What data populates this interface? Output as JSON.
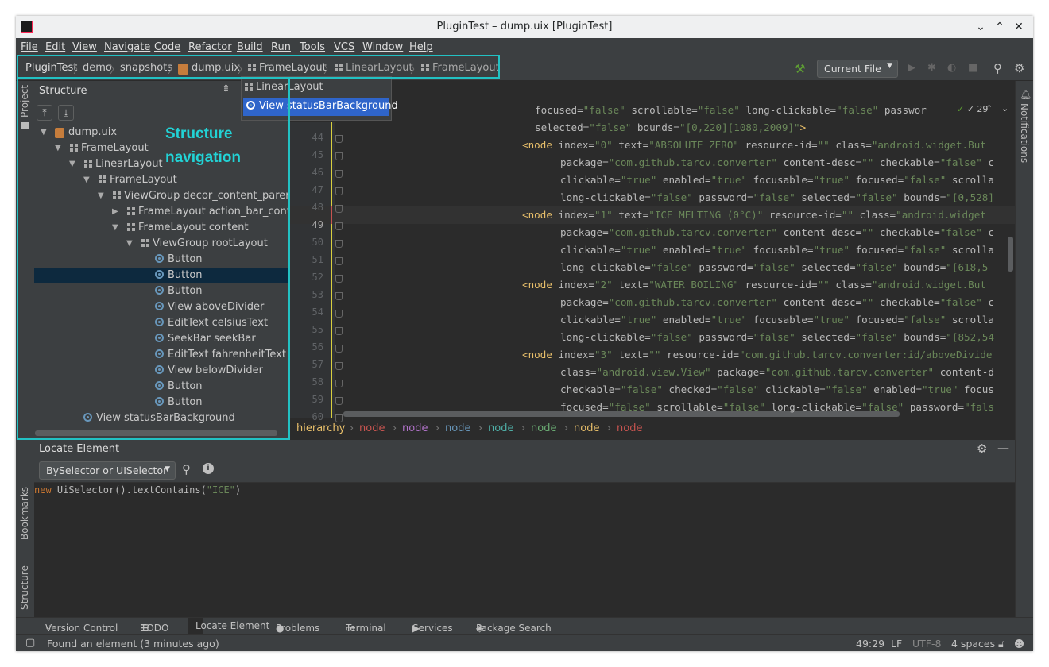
{
  "window": {
    "title": "PluginTest – dump.uix [PluginTest]"
  },
  "menu": [
    "File",
    "Edit",
    "View",
    "Navigate",
    "Code",
    "Refactor",
    "Build",
    "Run",
    "Tools",
    "VCS",
    "Window",
    "Help"
  ],
  "breadcrumbs": {
    "project": "PluginTest",
    "c1": "demo",
    "c2": "snapshots",
    "c3": "dump.uix",
    "c4": "FrameLayout",
    "c5": "LinearLayout",
    "c6": "FrameLayout"
  },
  "toolbar": {
    "run_config": "Current File"
  },
  "sidebar": {
    "project": "Project",
    "bookmarks": "Bookmarks",
    "structure": "Structure",
    "notifications": "Notifications"
  },
  "structure": {
    "title": "Structure",
    "rows": [
      {
        "label": "dump.uix"
      },
      {
        "label": "FrameLayout"
      },
      {
        "label": "LinearLayout"
      },
      {
        "label": "FrameLayout"
      },
      {
        "label": "ViewGroup decor_content_parent"
      },
      {
        "label": "FrameLayout action_bar_contain"
      },
      {
        "label": "FrameLayout content"
      },
      {
        "label": "ViewGroup rootLayout"
      },
      {
        "label": "Button"
      },
      {
        "label": "Button"
      },
      {
        "label": "Button"
      },
      {
        "label": "View aboveDivider"
      },
      {
        "label": "EditText celsiusText"
      },
      {
        "label": "SeekBar seekBar"
      },
      {
        "label": "EditText fahrenheitText"
      },
      {
        "label": "View belowDivider"
      },
      {
        "label": "Button"
      },
      {
        "label": "Button"
      },
      {
        "label": "View statusBarBackground"
      }
    ]
  },
  "popup": {
    "item1": "LinearLayout",
    "item2": "View statusBarBackground"
  },
  "annotation": {
    "line1": "Structure",
    "line2": "navigation"
  },
  "editor": {
    "line_numbers": [
      "44",
      "45",
      "46",
      "47",
      "48",
      "49",
      "50",
      "51",
      "52",
      "53",
      "54",
      "55",
      "56",
      "57",
      "58",
      "59",
      "60"
    ],
    "inspection": "✓ 29",
    "lines": [
      {
        "k": "",
        "a": "focused=",
        "v": "\"false\"",
        "rest": " scrollable=\"false\" long-clickable=\"false\" passwor"
      },
      {
        "k": "",
        "a": "selected=",
        "v": "\"false\"",
        "rest": " bounds=\"[0,220][1080,2009]\">"
      },
      {
        "k": "<node",
        "a": " index=",
        "v": "\"0\"",
        "rest": " text=\"ABSOLUTE ZERO\" resource-id=\"\" class=\"android.widget.But"
      },
      {
        "k": "",
        "a": "package=",
        "v": "\"com.github.tarcv.converter\"",
        "rest": " content-desc=\"\" checkable=\"false\" c"
      },
      {
        "k": "",
        "a": "clickable=",
        "v": "\"true\"",
        "rest": " enabled=\"true\" focusable=\"true\" focused=\"false\" scrolla"
      },
      {
        "k": "",
        "a": "long-clickable=",
        "v": "\"false\"",
        "rest": " password=\"false\" selected=\"false\" bounds=\"[0,528]"
      },
      {
        "k": "<node",
        "a": " index=",
        "v": "\"1\"",
        "rest": " text=\"ICE MELTING (0°C)\" resource-id=\"\" class=\"android.widget"
      },
      {
        "k": "",
        "a": "package=",
        "v": "\"com.github.tarcv.converter\"",
        "rest": " content-desc=\"\" checkable=\"false\" c"
      },
      {
        "k": "",
        "a": "clickable=",
        "v": "\"true\"",
        "rest": " enabled=\"true\" focusable=\"true\" focused=\"false\" scrolla"
      },
      {
        "k": "",
        "a": "long-clickable=",
        "v": "\"false\"",
        "rest": " password=\"false\" selected=\"false\" bounds=\"[618,5"
      },
      {
        "k": "<node",
        "a": " index=",
        "v": "\"2\"",
        "rest": " text=\"WATER BOILING\" resource-id=\"\" class=\"android.widget.But"
      },
      {
        "k": "",
        "a": "package=",
        "v": "\"com.github.tarcv.converter\"",
        "rest": " content-desc=\"\" checkable=\"false\" c"
      },
      {
        "k": "",
        "a": "clickable=",
        "v": "\"true\"",
        "rest": " enabled=\"true\" focusable=\"true\" focused=\"false\" scrolla"
      },
      {
        "k": "",
        "a": "long-clickable=",
        "v": "\"false\"",
        "rest": " password=\"false\" selected=\"false\" bounds=\"[852,54"
      },
      {
        "k": "<node",
        "a": " index=",
        "v": "\"3\"",
        "rest": " text=\"\" resource-id=\"com.github.tarcv.converter:id/aboveDivide"
      },
      {
        "k": "",
        "a": "class=",
        "v": "\"android.view.View\"",
        "rest": " package=\"com.github.tarcv.converter\" content-d"
      },
      {
        "k": "",
        "a": "checkable=",
        "v": "\"false\"",
        "rest": " checked=\"false\" clickable=\"false\" enabled=\"true\" focus"
      },
      {
        "k": "",
        "a": "focused=",
        "v": "\"false\"",
        "rest": " scrollable=\"false\" long-clickable=\"false\" password=\"fals"
      }
    ],
    "breadcrumb": [
      "hierarchy",
      "node",
      "node",
      "node",
      "node",
      "node",
      "node",
      "node"
    ]
  },
  "locate": {
    "title": "Locate Element",
    "selector": "BySelector or UISelector",
    "code_new": "new",
    "code_expr": "UiSelector().textContains(",
    "code_str": "\"ICE\"",
    "code_end": ")"
  },
  "bottom_tabs": [
    "Version Control",
    "TODO",
    "Locate Element",
    "Problems",
    "Terminal",
    "Services",
    "Package Search"
  ],
  "status": {
    "message": "Found an element (3 minutes ago)",
    "position": "49:29",
    "line_sep": "LF",
    "encoding": "UTF-8",
    "indent": "4 spaces"
  },
  "colors": {
    "accent": "#22c1c3",
    "selection": "#0d293e",
    "popup_selection": "#2f65ca"
  }
}
